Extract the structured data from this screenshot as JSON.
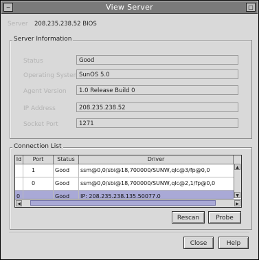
{
  "window": {
    "title": "View Server"
  },
  "server": {
    "label": "Server",
    "value": "208.235.238.52 BIOS"
  },
  "info_group": {
    "title": "Server Information",
    "fields": [
      {
        "label": "Status",
        "value": "Good"
      },
      {
        "label": "Operating System",
        "value": "SunOS 5.0"
      },
      {
        "label": "Agent Version",
        "value": "1.0 Release Build 0"
      },
      {
        "label": "IP Address",
        "value": "208.235.238.52"
      },
      {
        "label": "Socket Port",
        "value": "1271"
      }
    ]
  },
  "connections": {
    "title": "Connection List",
    "columns": [
      "Id",
      "Port",
      "Status",
      "Driver"
    ],
    "rows": [
      {
        "id": "",
        "port": "1",
        "status": "Good",
        "driver": "ssm@0,0/sbi@18,700000/SUNW,qlc@3/fp@0,0",
        "selected": false
      },
      {
        "id": "",
        "port": "0",
        "status": "Good",
        "driver": "ssm@0,0/sbi@18,700000/SUNW,qlc@2,1/fp@0,0",
        "selected": false
      },
      {
        "id": "0",
        "port": "",
        "status": "Good",
        "driver": "IP: 208.235.238.135.50077.0",
        "selected": true
      }
    ]
  },
  "buttons": {
    "rescan": "Rescan",
    "probe": "Probe",
    "close": "Close",
    "help": "Help"
  },
  "colors": {
    "titlebar": "#7a7a7a",
    "selection": "#a9a9d6",
    "panel": "#d9d9d9"
  },
  "icons": {
    "sys_menu": "dash-icon",
    "maximize": "square-icon",
    "scroll_up": "arrow-up-icon",
    "scroll_down": "arrow-down-icon",
    "scroll_left": "arrow-left-icon",
    "scroll_right": "arrow-right-icon"
  }
}
